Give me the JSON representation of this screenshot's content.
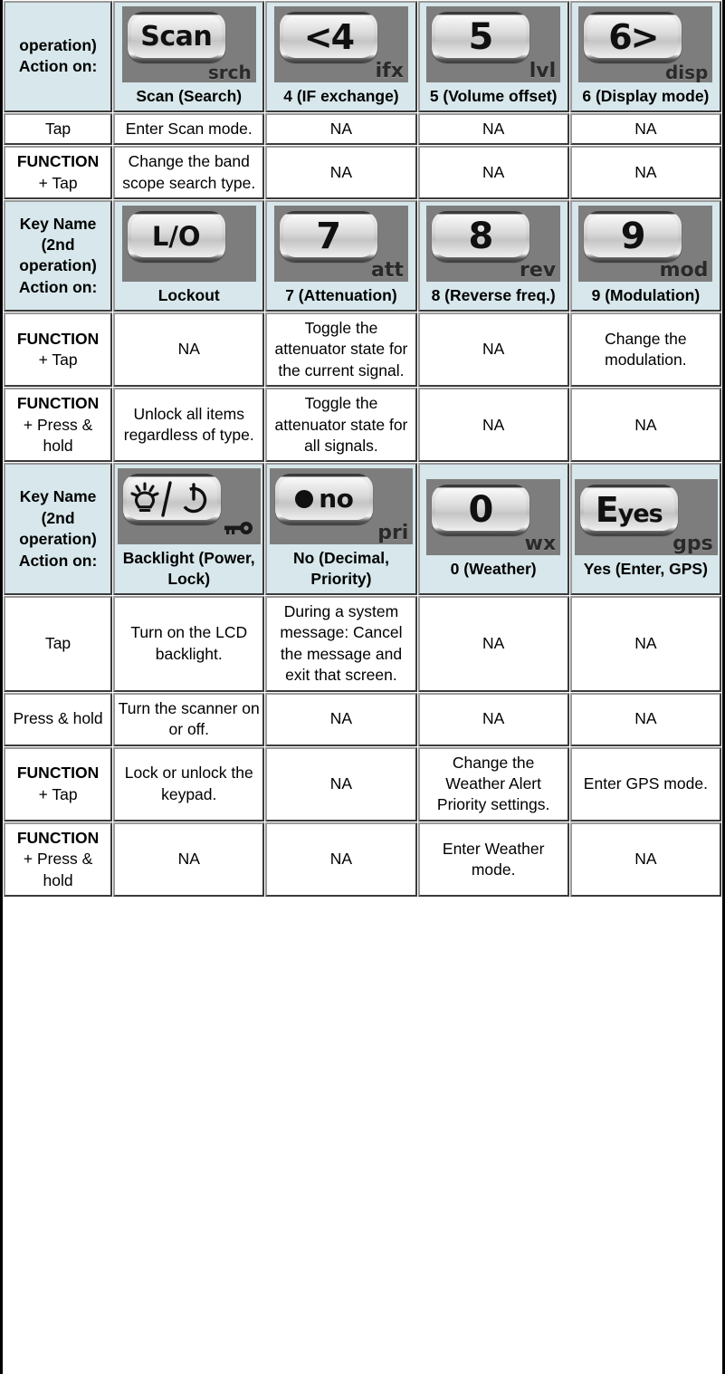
{
  "colors": {
    "header_bg": "#d7e7eb",
    "cell_bg": "#ffffff",
    "key_plate": "#7d7d7d",
    "border": "#8e8e8e",
    "text": "#000000"
  },
  "sections": [
    {
      "header": {
        "row_label_lines": [
          "operation)",
          "Action on:"
        ],
        "keys": [
          {
            "cap": "Scan",
            "cap_kind": "word",
            "sub": "srch",
            "name": "Scan (Search)",
            "icon": "scan-key"
          },
          {
            "cap": "<4",
            "cap_kind": "lt4",
            "sub": "ifx",
            "name": "4 (IF exchange)",
            "icon": "four-key"
          },
          {
            "cap": "5",
            "cap_kind": "num",
            "sub": "lvl",
            "name": "5 (Volume offset)",
            "icon": "five-key"
          },
          {
            "cap": "6>",
            "cap_kind": "gt6",
            "sub": "disp",
            "name": "6 (Display mode)",
            "icon": "six-key"
          }
        ]
      },
      "rows": [
        {
          "action_bold": "",
          "action_plain": "Tap",
          "cells": [
            "Enter Scan mode.",
            "NA",
            "NA",
            "NA"
          ]
        },
        {
          "action_bold": "FUNCTION",
          "action_plain": "+ Tap",
          "cells": [
            "Change the band scope search type.",
            "NA",
            "NA",
            "NA"
          ]
        }
      ]
    },
    {
      "header": {
        "row_label_lines": [
          "Key Name",
          "(2nd",
          "operation)",
          "Action on:"
        ],
        "keys": [
          {
            "cap": "L/O",
            "cap_kind": "lo",
            "sub": "",
            "name": "Lockout",
            "icon": "lockout-key"
          },
          {
            "cap": "7",
            "cap_kind": "num",
            "sub": "att",
            "name": "7 (Attenuation)",
            "icon": "seven-key"
          },
          {
            "cap": "8",
            "cap_kind": "num",
            "sub": "rev",
            "name": "8 (Reverse freq.)",
            "icon": "eight-key"
          },
          {
            "cap": "9",
            "cap_kind": "num",
            "sub": "mod",
            "name": "9 (Modulation)",
            "icon": "nine-key"
          }
        ]
      },
      "rows": [
        {
          "action_bold": "FUNCTION",
          "action_plain": "+ Tap",
          "cells": [
            "NA",
            "Toggle the attenuator state for the current signal.",
            "NA",
            "Change the modulation."
          ]
        },
        {
          "action_bold": "FUNCTION",
          "action_plain": "+ Press & hold",
          "cells": [
            "Unlock all items regardless of type.",
            "Toggle the attenuator state for all signals.",
            "NA",
            "NA"
          ]
        }
      ]
    },
    {
      "header": {
        "row_label_lines": [
          "Key Name",
          "(2nd",
          "operation)",
          "Action on:"
        ],
        "keys": [
          {
            "cap": "backlight-power",
            "cap_kind": "glyph",
            "sub": "",
            "name": "Backlight (Power, Lock)",
            "icon": "backlight-power-key"
          },
          {
            "cap": "no",
            "cap_kind": "no",
            "sub": "pri",
            "name": "No (Decimal, Priority)",
            "icon": "no-key"
          },
          {
            "cap": "0",
            "cap_kind": "num",
            "sub": "wx",
            "name": "0 (Weather)",
            "icon": "zero-key"
          },
          {
            "cap": "Eyes",
            "cap_kind": "eyes",
            "sub": "gps",
            "name": "Yes (Enter, GPS)",
            "icon": "yes-key"
          }
        ]
      },
      "rows": [
        {
          "action_bold": "",
          "action_plain": "Tap",
          "cells": [
            "Turn on the LCD backlight.",
            "During a system message: Cancel the message and exit that screen.",
            "NA",
            "NA"
          ]
        },
        {
          "action_bold": "",
          "action_plain": "Press & hold",
          "cells": [
            "Turn the scanner on or off.",
            "NA",
            "NA",
            "NA"
          ]
        },
        {
          "action_bold": "FUNCTION",
          "action_plain": "+ Tap",
          "cells": [
            "Lock or unlock the keypad.",
            "NA",
            "Change the Weather Alert Priority settings.",
            "Enter GPS mode."
          ]
        },
        {
          "action_bold": "FUNCTION",
          "action_plain": "+ Press & hold",
          "cells": [
            "NA",
            "NA",
            "Enter Weather mode.",
            "NA"
          ]
        }
      ]
    }
  ]
}
